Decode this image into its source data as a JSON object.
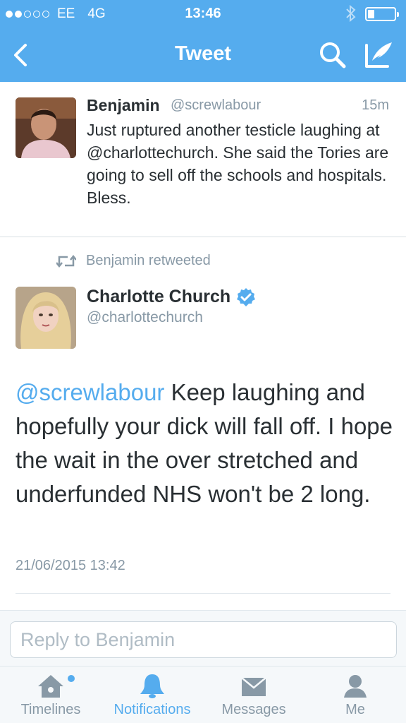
{
  "status": {
    "carrier": "EE",
    "network": "4G",
    "time": "13:46"
  },
  "nav": {
    "title": "Tweet"
  },
  "tweet1": {
    "name": "Benjamin",
    "handle": "@screwlabour",
    "time": "15m",
    "text": "Just ruptured another testicle laughing at @charlottechurch. She said the Tories are going to sell off the schools and hospitals. Bless."
  },
  "retweet": {
    "label": "Benjamin retweeted"
  },
  "tweet2": {
    "name": "Charlotte Church",
    "handle": "@charlottechurch",
    "mention": "@screwlabour",
    "text": " Keep laughing and hopefully your dick will fall off. I hope the wait in the over stretched and underfunded NHS won't be 2 long.",
    "date": "21/06/2015 13:42"
  },
  "reply": {
    "placeholder": "Reply to Benjamin"
  },
  "tabs": [
    {
      "label": "Timelines"
    },
    {
      "label": "Notifications"
    },
    {
      "label": "Messages"
    },
    {
      "label": "Me"
    }
  ],
  "colors": {
    "brand": "#55acee",
    "text": "#292f33",
    "muted": "#8899a6"
  }
}
